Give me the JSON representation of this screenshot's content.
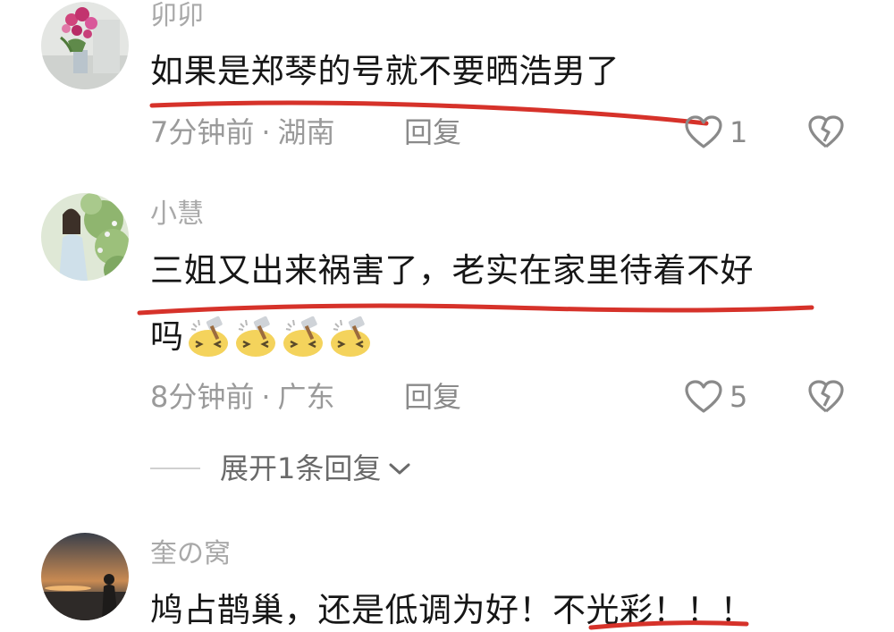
{
  "comments": [
    {
      "username": "卯卯",
      "text": "如果是郑琴的号就不要晒浩男了",
      "time": "7分钟前",
      "separator": "·",
      "location": "湖南",
      "reply_label": "回复",
      "likes": "1"
    },
    {
      "username": "小慧",
      "text_line1": "三姐又出来祸害了，老实在家里待着不好",
      "text_line2": "吗",
      "emoji_count": 4,
      "emoji_name": "hammer-face-emoji",
      "time": "8分钟前",
      "separator": "·",
      "location": "广东",
      "reply_label": "回复",
      "likes": "5",
      "expand_label": "展开1条回复"
    },
    {
      "username": "奎の窝",
      "text": "鸠占鹊巢，还是低调为好！不光彩！！！"
    }
  ],
  "icons": {
    "like": "heart-outline-icon",
    "dislike": "broken-heart-icon",
    "expand": "chevron-down-icon"
  },
  "colors": {
    "annotation_underline": "#d6322a",
    "username": "#a9a9a9",
    "meta": "#9a9a9a",
    "text": "#161616"
  }
}
